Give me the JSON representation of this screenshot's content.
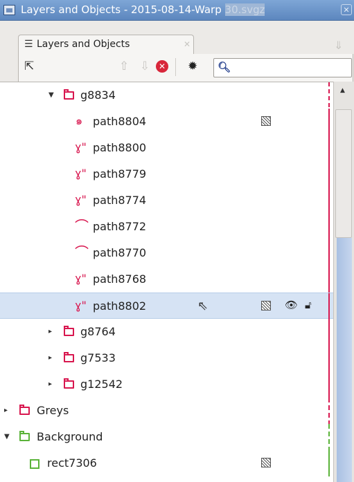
{
  "window": {
    "title": "Layers and Objects - 2015-08-14-Warp",
    "title_suffix": "30.svgz",
    "close_glyph": "✕"
  },
  "tab": {
    "label": "Layers and Objects",
    "close_glyph": "✕"
  },
  "toolbar": {
    "search_placeholder": "",
    "search_value": ""
  },
  "tree": [
    {
      "label": "g8834",
      "type": "group",
      "expanded": true
    },
    {
      "label": "path8804",
      "type": "spiral",
      "blend": true
    },
    {
      "label": "path8800",
      "type": "path"
    },
    {
      "label": "path8779",
      "type": "path"
    },
    {
      "label": "path8774",
      "type": "path"
    },
    {
      "label": "path8772",
      "type": "arc"
    },
    {
      "label": "path8770",
      "type": "arc"
    },
    {
      "label": "path8768",
      "type": "path"
    },
    {
      "label": "path8802",
      "type": "path",
      "selected": true,
      "blend": true,
      "eye": true,
      "lock": true
    },
    {
      "label": "g8764",
      "type": "group",
      "expanded": false
    },
    {
      "label": "g7533",
      "type": "group",
      "expanded": false
    },
    {
      "label": "g12542",
      "type": "group",
      "expanded": false
    },
    {
      "label": "Greys",
      "type": "layer",
      "expanded": false
    },
    {
      "label": "Background",
      "type": "layer",
      "expanded": true
    },
    {
      "label": "rect7306",
      "type": "rect",
      "blend": true
    }
  ],
  "colors": {
    "layer_pink": "#d8174f",
    "layer_green": "#5bb33a",
    "selection": "#d6e3f4",
    "titlebar": "#5c86be"
  }
}
